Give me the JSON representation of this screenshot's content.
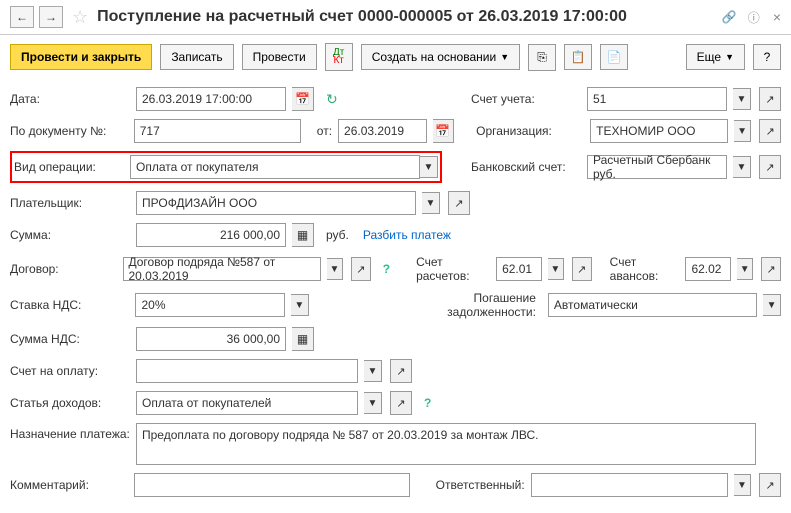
{
  "header": {
    "title": "Поступление на расчетный счет 0000-000005 от 26.03.2019 17:00:00"
  },
  "buttons": {
    "submit_close": "Провести и закрыть",
    "save": "Записать",
    "submit": "Провести",
    "create_based": "Создать на основании",
    "more": "Еще"
  },
  "labels": {
    "date": "Дата:",
    "doc_no": "По документу №:",
    "from": "от:",
    "op_type": "Вид операции:",
    "payer": "Плательщик:",
    "sum": "Сумма:",
    "rub": "руб.",
    "split": "Разбить платеж",
    "contract": "Договор:",
    "vat_rate": "Ставка НДС:",
    "vat_sum": "Сумма НДС:",
    "invoice": "Счет на оплату:",
    "income_item": "Статья доходов:",
    "purpose": "Назначение платежа:",
    "comment": "Комментарий:",
    "account": "Счет учета:",
    "org": "Организация:",
    "bank_acct": "Банковский счет:",
    "settle_acct": "Счет расчетов:",
    "advance_acct": "Счет авансов:",
    "debt_repay": "Погашение задолженности:",
    "responsible": "Ответственный:"
  },
  "values": {
    "date": "26.03.2019 17:00:00",
    "doc_no": "717",
    "doc_date": "26.03.2019",
    "op_type": "Оплата от покупателя",
    "payer": "ПРОФДИЗАЙН ООО",
    "sum": "216 000,00",
    "contract": "Договор подряда №587 от 20.03.2019",
    "vat_rate": "20%",
    "vat_sum": "36 000,00",
    "invoice": "",
    "income_item": "Оплата от покупателей",
    "purpose": "Предоплата по договору подряда № 587 от 20.03.2019 за монтаж ЛВС.",
    "comment": "",
    "account": "51",
    "org": "ТЕХНОМИР ООО",
    "bank_acct": "Расчетный Сбербанк руб.",
    "settle_acct": "62.01",
    "advance_acct": "62.02",
    "debt_repay": "Автоматически",
    "responsible": ""
  }
}
